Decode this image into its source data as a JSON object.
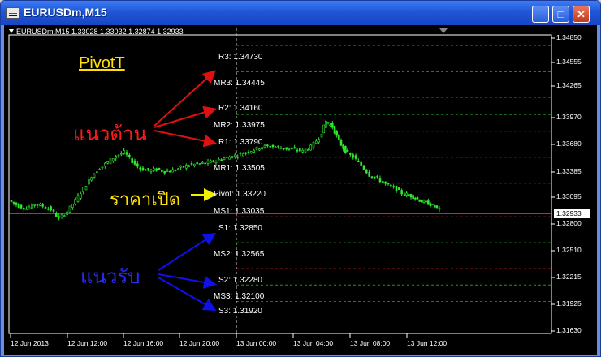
{
  "window": {
    "title": "EURUSDm,M15",
    "min": "_",
    "max": "□",
    "close": "✕"
  },
  "chart_header": "EURUSDm,M15  1.33028 1.33032 1.32874 1.32933",
  "current_price": "1.32933",
  "pivot_labels": {
    "r3": "R3: 1.34730",
    "mr3": "MR3: 1.34445",
    "r2": "R2: 1.34160",
    "mr2": "MR2: 1.33975",
    "r1": "R1: 1.33790",
    "mr1": "MR1: 1.33505",
    "pivot": "Pivot: 1.33220",
    "ms1": "MS1: 1.33035",
    "s1": "S1: 1.32850",
    "ms2": "MS2: 1.32565",
    "s2": "S2: 1.32280",
    "ms3": "MS3: 1.32100",
    "s3": "S3: 1.31920"
  },
  "y_ticks": [
    "1.34850",
    "1.34555",
    "1.34265",
    "1.33970",
    "1.33680",
    "1.33385",
    "1.33095",
    "1.32800",
    "1.32510",
    "1.32215",
    "1.31925",
    "1.31630"
  ],
  "x_ticks": [
    "12 Jun 2013",
    "12 Jun 12:00",
    "12 Jun 16:00",
    "12 Jun 20:00",
    "13 Jun 00:00",
    "13 Jun 04:00",
    "13 Jun 08:00",
    "13 Jun 12:00"
  ],
  "annotations": {
    "title": "PivotT",
    "resistance": "แนวต้าน",
    "open_price": "ราคาเปิด",
    "support": "แนวรับ"
  },
  "colors": {
    "resistance_line": "#1a1aff",
    "mid_line": "#1a9a1a",
    "pivot_line": "#c020c0",
    "support_line": "#d02020",
    "candle": "#2ee82e",
    "price_line": "#b0b0b0"
  }
}
